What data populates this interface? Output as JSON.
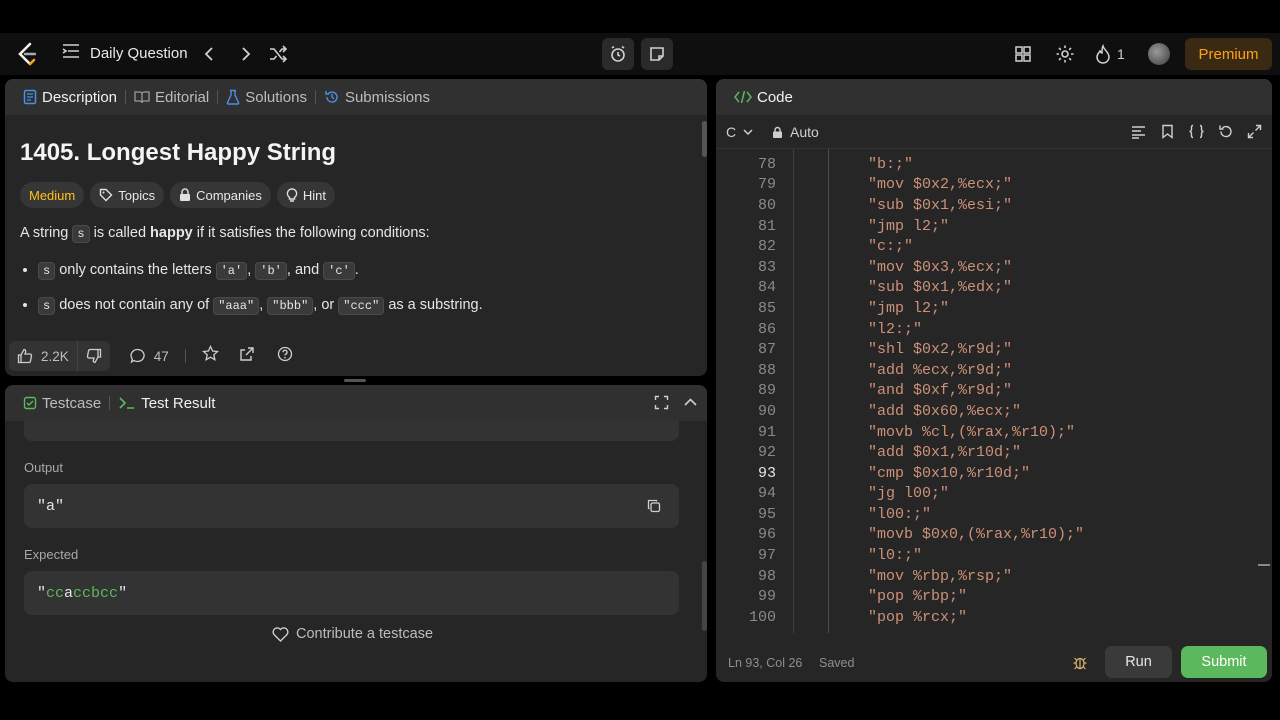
{
  "nav": {
    "title": "Daily Question",
    "streak": "1",
    "premium": "Premium"
  },
  "left_tabs": [
    "Description",
    "Editorial",
    "Solutions",
    "Submissions"
  ],
  "problem": {
    "title": "1405. Longest Happy String",
    "difficulty": "Medium",
    "chips": [
      "Topics",
      "Companies",
      "Hint"
    ],
    "intro_pre": "A string ",
    "intro_s": "s",
    "intro_mid": " is called ",
    "intro_bold": "happy",
    "intro_post": " if it satisfies the following conditions:",
    "bullet1": {
      "s": "s",
      "t1": " only contains the letters ",
      "a": "'a'",
      "c1": ", ",
      "b": "'b'",
      "c2": ", and ",
      "c": "'c'",
      "end": "."
    },
    "bullet2": {
      "s": "s",
      "t1": " does not contain any of ",
      "a": "\"aaa\"",
      "c1": ", ",
      "b": "\"bbb\"",
      "c2": ", or ",
      "c": "\"ccc\"",
      "end": " as a substring."
    }
  },
  "actions": {
    "likes": "2.2K",
    "comments": "47"
  },
  "bottom_tabs": {
    "testcase": "Testcase",
    "result": "Test Result"
  },
  "result": {
    "output_label": "Output",
    "output_value": "\"a\"",
    "expected_label": "Expected",
    "expected_q1": "\"",
    "expected_part1": "cc",
    "expected_part2": "a",
    "expected_part3": "ccbcc",
    "expected_q2": "\"",
    "contribute": "Contribute a testcase"
  },
  "code_panel": {
    "title": "Code",
    "lang": "C",
    "mode": "Auto",
    "status_pos": "Ln 93, Col 26",
    "status_saved": "Saved",
    "run": "Run",
    "submit": "Submit",
    "current_line": "93",
    "lines": [
      {
        "n": "78",
        "code": "\"b:;\""
      },
      {
        "n": "79",
        "code": "\"mov $0x2,%ecx;\""
      },
      {
        "n": "80",
        "code": "\"sub $0x1,%esi;\""
      },
      {
        "n": "81",
        "code": "\"jmp l2;\""
      },
      {
        "n": "82",
        "code": "\"c:;\""
      },
      {
        "n": "83",
        "code": "\"mov $0x3,%ecx;\""
      },
      {
        "n": "84",
        "code": "\"sub $0x1,%edx;\""
      },
      {
        "n": "85",
        "code": "\"jmp l2;\""
      },
      {
        "n": "86",
        "code": "\"l2:;\""
      },
      {
        "n": "87",
        "code": "\"shl $0x2,%r9d;\""
      },
      {
        "n": "88",
        "code": "\"add %ecx,%r9d;\""
      },
      {
        "n": "89",
        "code": "\"and $0xf,%r9d;\""
      },
      {
        "n": "90",
        "code": "\"add $0x60,%ecx;\""
      },
      {
        "n": "91",
        "code": "\"movb %cl,(%rax,%r10);\""
      },
      {
        "n": "92",
        "code": "\"add $0x1,%r10d;\""
      },
      {
        "n": "93",
        "code": "\"cmp $0x10,%r10d;\""
      },
      {
        "n": "94",
        "code": "\"jg l00;\""
      },
      {
        "n": "95",
        "code": "\"l00:;\""
      },
      {
        "n": "96",
        "code": "\"movb $0x0,(%rax,%r10);\""
      },
      {
        "n": "97",
        "code": "\"l0:;\""
      },
      {
        "n": "98",
        "code": "\"mov %rbp,%rsp;\""
      },
      {
        "n": "99",
        "code": "\"pop %rbp;\""
      },
      {
        "n": "100",
        "code": "\"pop %rcx;\""
      }
    ]
  },
  "colors": {
    "accent_green": "#5cb85c",
    "medium": "#ffc01e",
    "code_string": "#ce9178"
  }
}
